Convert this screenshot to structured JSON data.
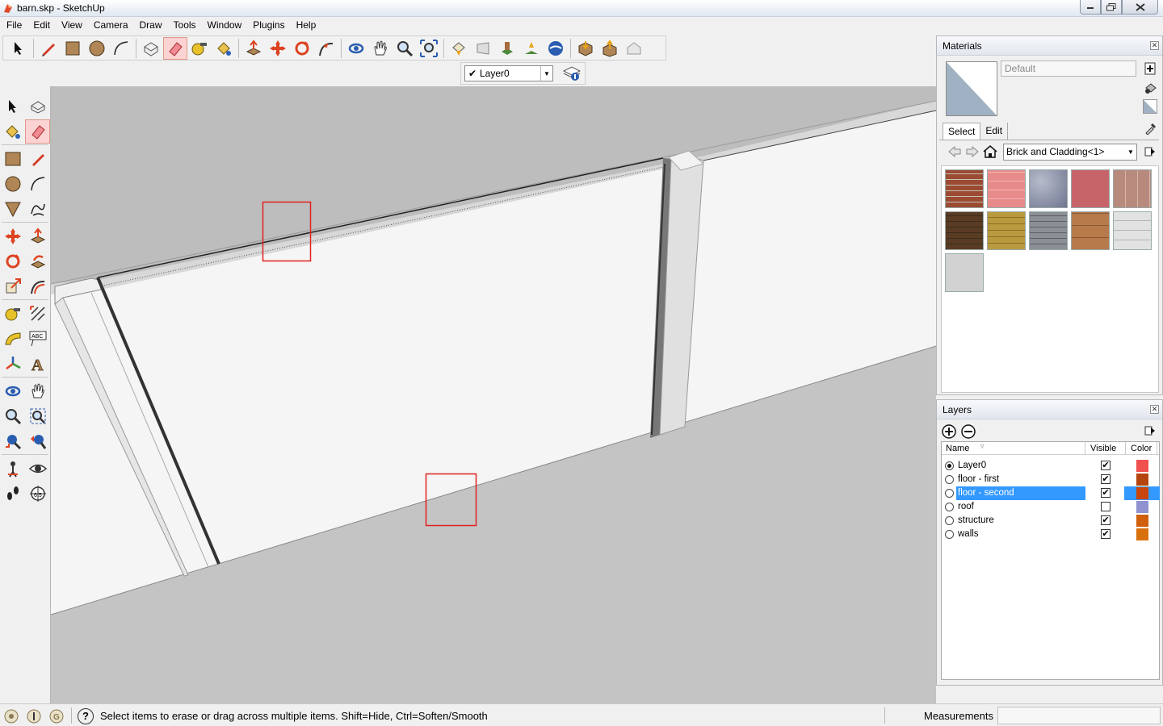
{
  "window": {
    "title": "barn.skp - SketchUp",
    "buttons": [
      "minimize",
      "maximize",
      "close"
    ]
  },
  "menu": [
    "File",
    "Edit",
    "View",
    "Camera",
    "Draw",
    "Tools",
    "Window",
    "Plugins",
    "Help"
  ],
  "toolbar": {
    "tools": [
      "select-icon",
      "pencil-icon",
      "rectangle-icon",
      "circle-icon",
      "arc-icon",
      "make-component-icon",
      "eraser-icon",
      "tape-measure-icon",
      "paint-bucket-icon",
      "push-pull-icon",
      "move-icon",
      "rotate-icon",
      "follow-me-icon",
      "orbit-icon",
      "pan-icon",
      "zoom-icon",
      "zoom-extents-icon",
      "previous-view-icon",
      "next-view-icon",
      "add-location-icon",
      "toggle-terrain-icon",
      "google-earth-icon",
      "get-models-icon",
      "share-model-icon",
      "share-component-icon"
    ]
  },
  "layer_toolbar": {
    "current_layer": "Layer0"
  },
  "materials": {
    "title": "Materials",
    "current_name": "Default",
    "tabs": [
      "Select",
      "Edit"
    ],
    "collection": "Brick and Cladding<1>",
    "swatch_colors": [
      "#9a4b32",
      "#e78a8a",
      "#8a8fa3",
      "#c7646a",
      "#b88a7e",
      "#5a3c24",
      "#b99a3e",
      "#8c8f96",
      "#b67a4b",
      "#d8d8d8",
      "#cfcfcf"
    ]
  },
  "layers": {
    "title": "Layers",
    "columns": {
      "name": "Name",
      "visible": "Visible",
      "color": "Color"
    },
    "rows": [
      {
        "name": "Layer0",
        "active": true,
        "visible": true,
        "color": "#f0504e"
      },
      {
        "name": "floor - first",
        "active": false,
        "visible": true,
        "color": "#b5450f"
      },
      {
        "name": "floor - second",
        "active": false,
        "visible": true,
        "color": "#c8450e",
        "selected": true
      },
      {
        "name": "roof",
        "active": false,
        "visible": false,
        "color": "#8f93d0"
      },
      {
        "name": "structure",
        "active": false,
        "visible": true,
        "color": "#d0600e"
      },
      {
        "name": "walls",
        "active": false,
        "visible": true,
        "color": "#d8700e"
      }
    ]
  },
  "status": {
    "message": "Select items to erase or drag across multiple items. Shift=Hide, Ctrl=Soften/Smooth",
    "measurements_label": "Measurements",
    "measurements_value": ""
  }
}
